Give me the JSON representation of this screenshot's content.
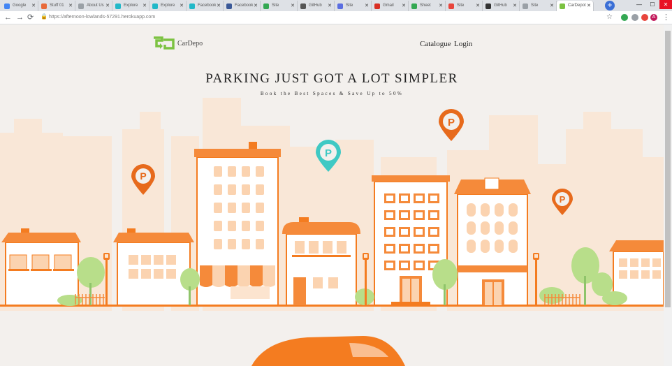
{
  "browser": {
    "tabs": [
      {
        "label": "Google",
        "color": "#4285f4"
      },
      {
        "label": "Stuff 01",
        "color": "#e86a3a"
      },
      {
        "label": "About Us",
        "color": "#9aa0a6"
      },
      {
        "label": "Explore",
        "color": "#22b8c8"
      },
      {
        "label": "Explore",
        "color": "#22b8c8"
      },
      {
        "label": "Facebook",
        "color": "#22b8c8"
      },
      {
        "label": "Facebook",
        "color": "#3b5998"
      },
      {
        "label": "Site",
        "color": "#34a853"
      },
      {
        "label": "GitHub",
        "color": "#555555"
      },
      {
        "label": "Site",
        "color": "#5b6ee1"
      },
      {
        "label": "Gmail",
        "color": "#d93025"
      },
      {
        "label": "Sheet",
        "color": "#34a853"
      },
      {
        "label": "Site",
        "color": "#e8453c"
      },
      {
        "label": "GitHub",
        "color": "#333333"
      },
      {
        "label": "Site",
        "color": "#9aa0a6"
      },
      {
        "label": "CarDepot",
        "color": "#7cc242"
      }
    ],
    "url": "https://afternoon-lowlands-57291.herokuapp.com",
    "new_tab_symbol": "+",
    "minimize_symbol": "—",
    "maximize_symbol": "☐",
    "close_symbol": "✕",
    "back_symbol": "←",
    "forward_symbol": "→",
    "reload_symbol": "⟳",
    "lock_symbol": "🔒",
    "star_symbol": "☆",
    "menu_symbol": "⋮",
    "profile_initial": "A"
  },
  "header": {
    "brand": "CarDepo",
    "nav": [
      "Catalogue",
      "Login"
    ]
  },
  "hero": {
    "title": "PARKING JUST GOT A LOT SIMPLER",
    "subtitle": "Book the Best Spaces & Save Up to 50%",
    "pin_letter": "P"
  },
  "colors": {
    "accent": "#f47c20",
    "teal": "#3fc9c4",
    "brand_green": "#7cc242",
    "skyline": "#f9e7d7",
    "tree": "#b8de8a"
  }
}
